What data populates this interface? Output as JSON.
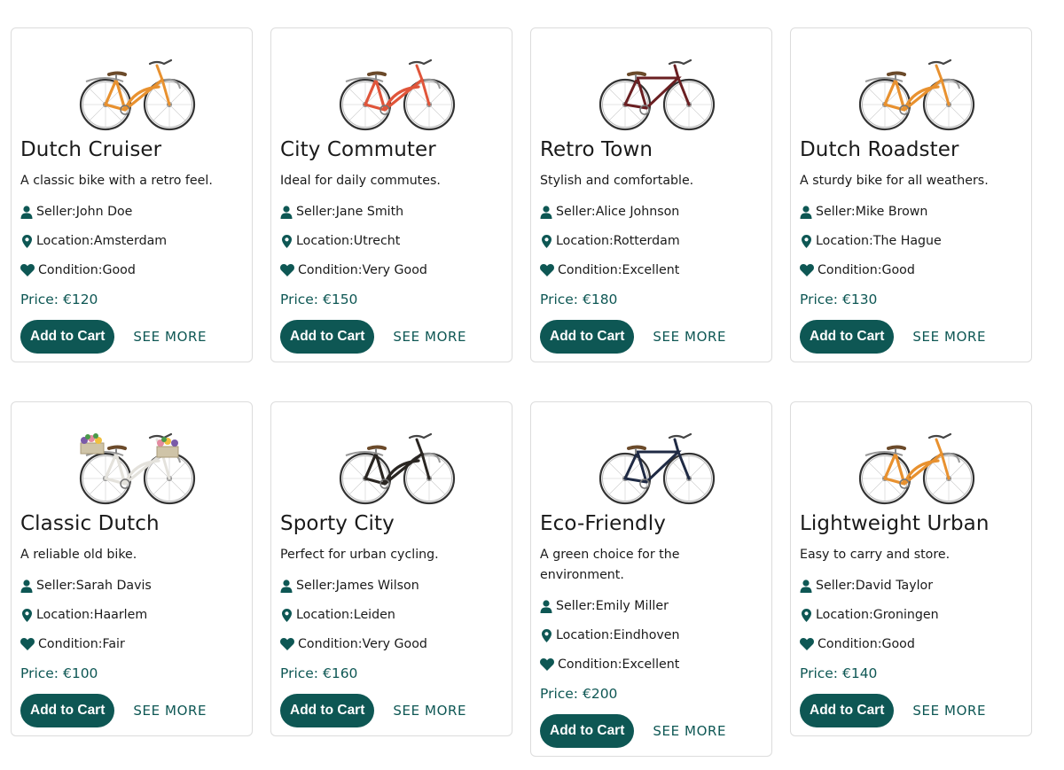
{
  "labels": {
    "seller_prefix": "Seller: ",
    "location_prefix": "Location: ",
    "condition_prefix": "Condition: ",
    "price_prefix": "Price: ",
    "add_to_cart": "Add to Cart",
    "see_more": "SEE MORE"
  },
  "colors": {
    "accent": "#0e5754",
    "card_border": "#dcdcdc"
  },
  "products": [
    {
      "title": "Dutch Cruiser",
      "description": "A classic bike with a retro feel.",
      "seller": "John Doe",
      "location": "Amsterdam",
      "condition": "Good",
      "price": "€120",
      "image": "orange-step-through-bike"
    },
    {
      "title": "City Commuter",
      "description": "Ideal for daily commutes.",
      "seller": "Jane Smith",
      "location": "Utrecht",
      "condition": "Very Good",
      "price": "€150",
      "image": "red-step-through-bike"
    },
    {
      "title": "Retro Town",
      "description": "Stylish and comfortable.",
      "seller": "Alice Johnson",
      "location": "Rotterdam",
      "condition": "Excellent",
      "price": "€180",
      "image": "maroon-diamond-frame-bike"
    },
    {
      "title": "Dutch Roadster",
      "description": "A sturdy bike for all weathers.",
      "seller": "Mike Brown",
      "location": "The Hague",
      "condition": "Good",
      "price": "€130",
      "image": "orange-step-through-bike"
    },
    {
      "title": "Classic Dutch",
      "description": "A reliable old bike.",
      "seller": "Sarah Davis",
      "location": "Haarlem",
      "condition": "Fair",
      "price": "€100",
      "image": "white-bike-with-flower-baskets"
    },
    {
      "title": "Sporty City",
      "description": "Perfect for urban cycling.",
      "seller": "James Wilson",
      "location": "Leiden",
      "condition": "Very Good",
      "price": "€160",
      "image": "black-vintage-bike"
    },
    {
      "title": "Eco-Friendly",
      "description": "A green choice for the environment.",
      "seller": "Emily Miller",
      "location": "Eindhoven",
      "condition": "Excellent",
      "price": "€200",
      "image": "navy-diamond-frame-bike"
    },
    {
      "title": "Lightweight Urban",
      "description": "Easy to carry and store.",
      "seller": "David Taylor",
      "location": "Groningen",
      "condition": "Good",
      "price": "€140",
      "image": "orange-step-through-bike"
    }
  ]
}
